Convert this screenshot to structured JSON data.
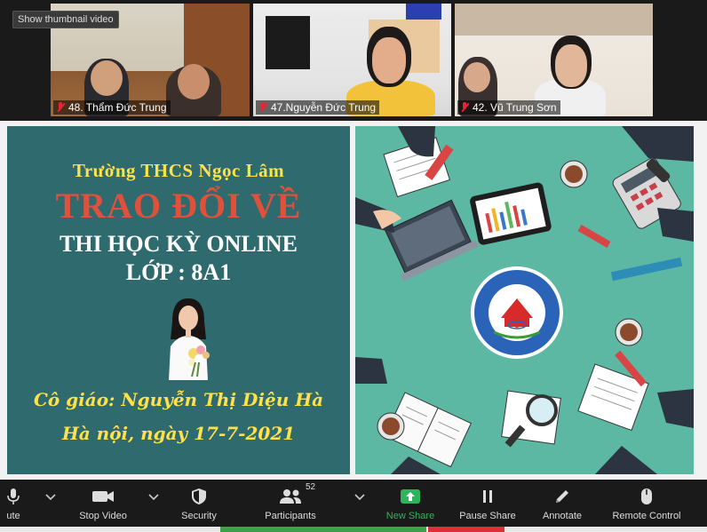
{
  "gallery": {
    "show_thumbnail_label": "Show thumbnail video",
    "participants": [
      {
        "name": "48. Thẩm Đức Trung",
        "muted": true
      },
      {
        "name": "47.Nguyễn Đức Trung",
        "muted": true
      },
      {
        "name": "42. Vũ Trung Sơn",
        "muted": true
      }
    ]
  },
  "slide": {
    "school": "Trường  THCS Ngọc Lâm",
    "headline": "TRAO ĐỔI VỀ",
    "subtitle": "THI HỌC KỲ ONLINE",
    "class_line": "LỚP : 8A1",
    "teacher": "Cô giáo: Nguyễn Thị Diệu Hà",
    "date": "Hà nội, ngày 17-7-2021",
    "logo": {
      "top_text": "TRƯỜNG TRUNG HỌC CƠ SỞ",
      "year": "1964",
      "bottom_text": "NGỌC LÂM"
    }
  },
  "toolbar": {
    "mute": "ute",
    "stop_video": "Stop Video",
    "security": "Security",
    "participants": "Participants",
    "participants_count": "52",
    "new_share": "New Share",
    "pause_share": "Pause Share",
    "annotate": "Annotate",
    "remote_control": "Remote Control"
  },
  "colors": {
    "slide_left_bg": "#2e6a6e",
    "slide_right_bg": "#5cb8a3",
    "accent_yellow": "#ffe14a",
    "headline_red": "#e0513b",
    "new_share_green": "#2db55d"
  }
}
